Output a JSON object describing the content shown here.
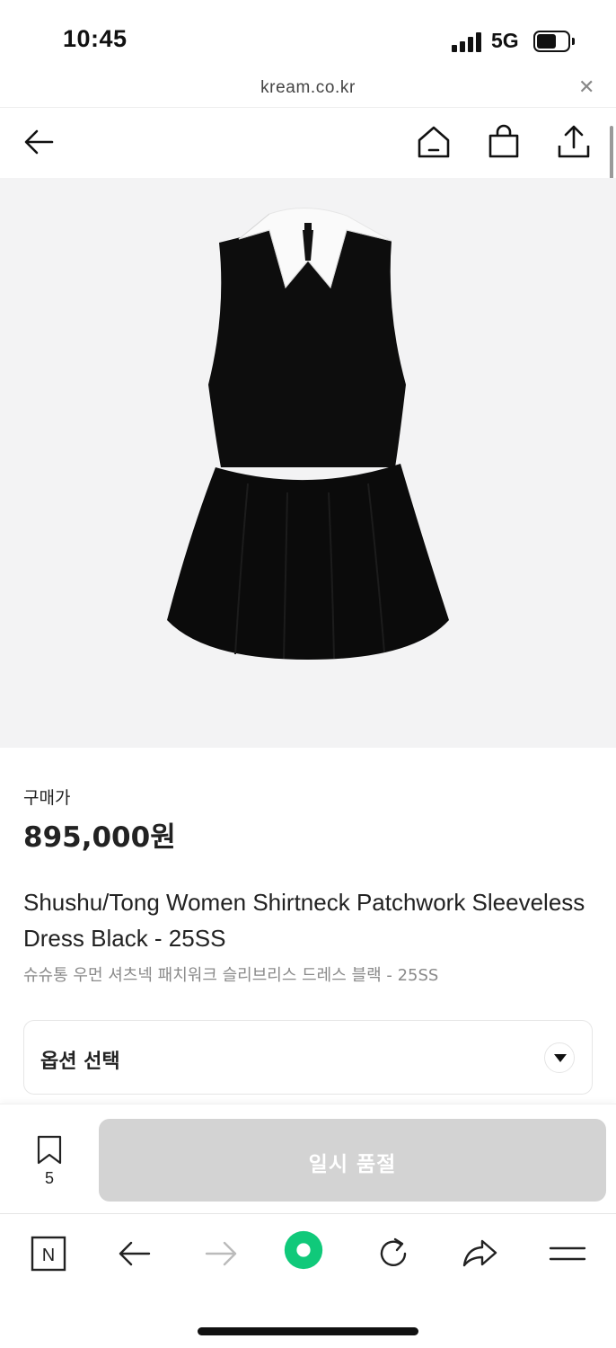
{
  "status_bar": {
    "time": "10:45",
    "network": "5G"
  },
  "browser": {
    "url": "kream.co.kr"
  },
  "header": {
    "back_icon": "arrow-left-icon",
    "home_icon": "home-icon",
    "shop_icon": "shopping-bag-icon",
    "share_icon": "share-upload-icon"
  },
  "product": {
    "image_alt": "black sleeveless dress with white shirt collar",
    "price_label": "구매가",
    "price": "895,000원",
    "title_en": "Shushu/Tong Women Shirtneck Patchwork Sleeveless Dress Black - 25SS",
    "title_ko": "슈슈통 우먼 셔츠넥 패치워크 슬리브리스 드레스 블랙 - 25SS"
  },
  "option": {
    "label": "옵션 선택"
  },
  "actions": {
    "bookmark_count": "5",
    "buy_button": "일시 품절"
  },
  "toolbar": {
    "items": [
      "naver-icon",
      "back-arrow-icon",
      "forward-arrow-icon",
      "green-circle-icon",
      "reload-icon",
      "share-arrow-icon",
      "menu-icon"
    ]
  },
  "colors": {
    "brand_green": "#10c97a",
    "disabled_button": "#d3d3d3",
    "image_bg": "#f3f3f4"
  }
}
